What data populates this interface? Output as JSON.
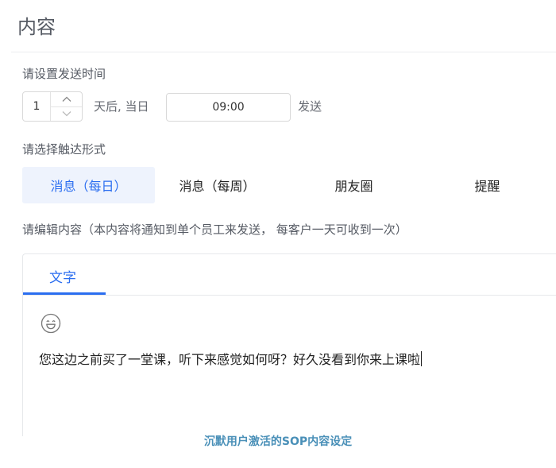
{
  "header": {
    "title": "内容"
  },
  "schedule": {
    "label": "请设置发送时间",
    "days_value": "1",
    "after_text": "天后, 当日",
    "time_value": "09:00",
    "send_text": "发送"
  },
  "form": {
    "label": "请选择触达形式",
    "options": [
      {
        "label": "消息（每日）",
        "selected": true
      },
      {
        "label": "消息（每周）",
        "selected": false
      },
      {
        "label": "朋友圈",
        "selected": false
      },
      {
        "label": "提醒",
        "selected": false
      }
    ]
  },
  "content": {
    "label": "请编辑内容（本内容将通知到单个员工来发送， 每客户一天可收到一次）",
    "tabs": [
      {
        "label": "文字",
        "active": true
      }
    ],
    "emoji_icon": "smiley-icon",
    "message": "您这边之前买了一堂课，听下来感觉如何呀？好久没看到你来上课啦"
  },
  "caption": "沉默用户激活的SOP内容设定",
  "colors": {
    "accent": "#2b6ef0",
    "active_bg": "#eef3fd",
    "caption": "#4a90b8"
  }
}
